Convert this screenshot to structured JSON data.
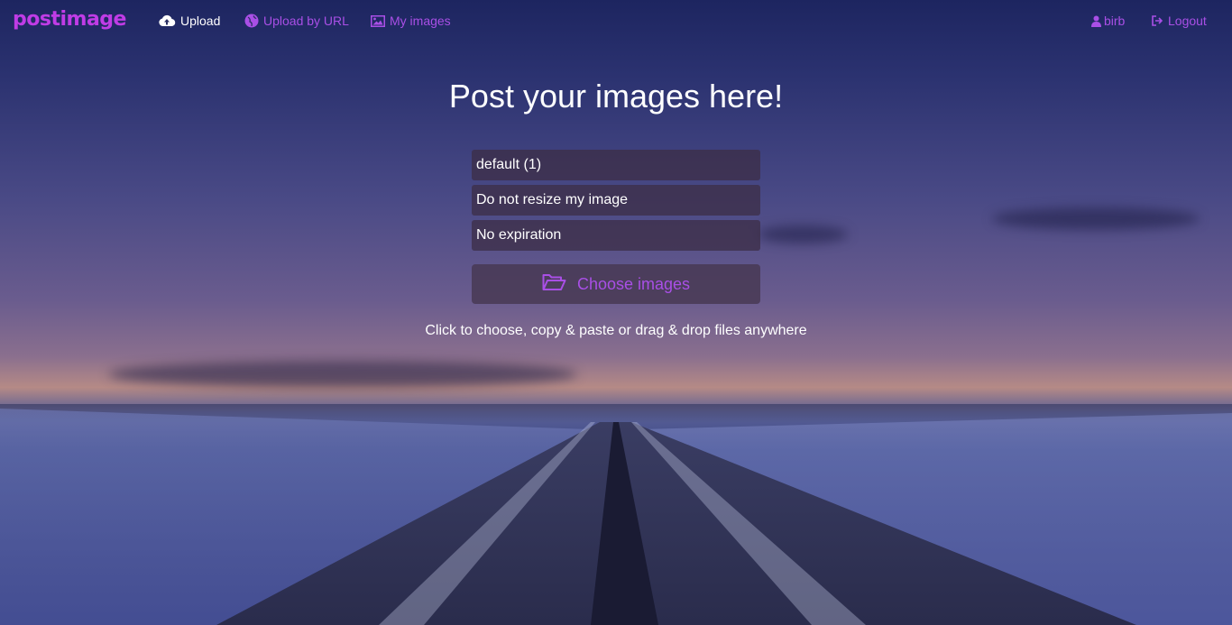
{
  "nav": {
    "logo": "postimage",
    "upload": "Upload",
    "upload_url": "Upload by URL",
    "my_images": "My images",
    "user": "birb",
    "logout": "Logout"
  },
  "main": {
    "title": "Post your images here!",
    "gallery_select": "default (1)",
    "resize_select": "Do not resize my image",
    "expiration_select": "No expiration",
    "choose_button": "Choose images",
    "hint": "Click to choose, copy & paste or drag & drop files anywhere"
  },
  "colors": {
    "accent": "#a94fe6",
    "logo": "#c03ce6"
  },
  "icons": [
    "cloud-upload-icon",
    "globe-icon",
    "image-icon",
    "user-icon",
    "logout-icon",
    "folder-open-icon"
  ]
}
